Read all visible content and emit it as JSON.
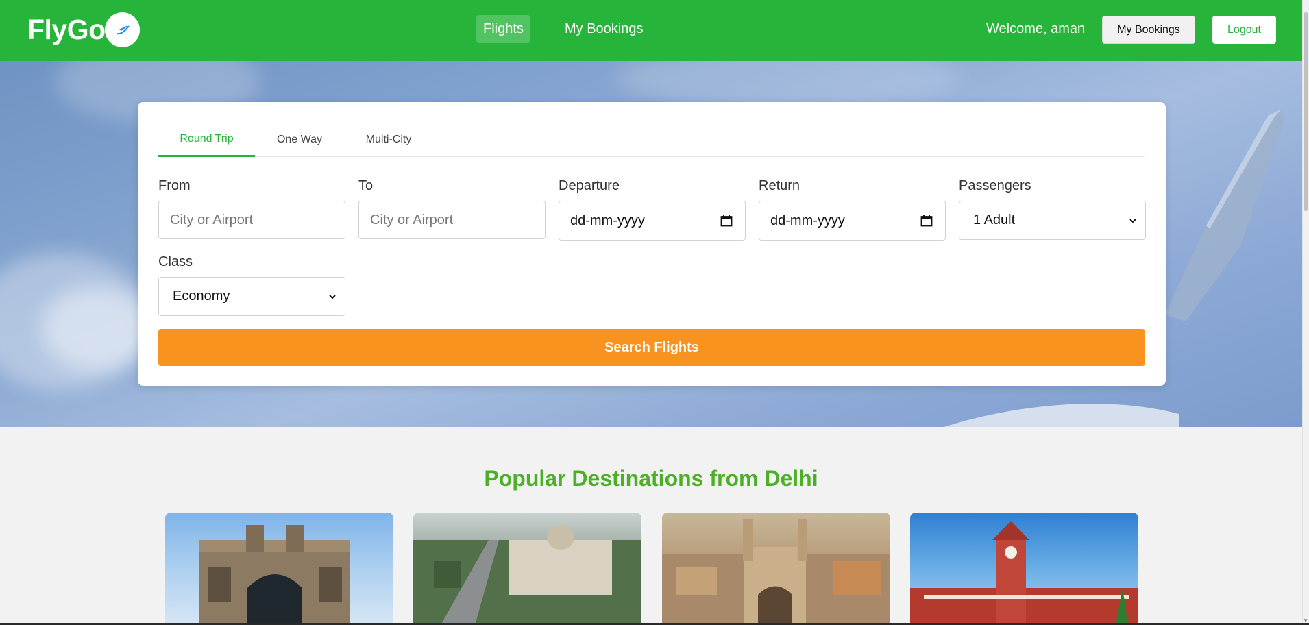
{
  "header": {
    "logo": "FlyGo",
    "nav": [
      {
        "label": "Flights",
        "active": true
      },
      {
        "label": "My Bookings",
        "active": false
      }
    ],
    "welcome": "Welcome, aman",
    "bookings_button": "My Bookings",
    "logout_button": "Logout"
  },
  "search": {
    "tabs": [
      {
        "label": "Round Trip",
        "active": true
      },
      {
        "label": "One Way",
        "active": false
      },
      {
        "label": "Multi-City",
        "active": false
      }
    ],
    "from": {
      "label": "From",
      "placeholder": "City or Airport"
    },
    "to": {
      "label": "To",
      "placeholder": "City or Airport"
    },
    "departure": {
      "label": "Departure",
      "value": "dd-mm-yyyy"
    },
    "return": {
      "label": "Return",
      "value": "dd-mm-yyyy"
    },
    "passengers": {
      "label": "Passengers",
      "value": "1 Adult"
    },
    "class": {
      "label": "Class",
      "value": "Economy"
    },
    "button": "Search Flights"
  },
  "destinations": {
    "title": "Popular Destinations from Delhi"
  },
  "colors": {
    "brand_green": "#26b53a",
    "title_green": "#4caf27",
    "search_orange": "#f7931e"
  }
}
